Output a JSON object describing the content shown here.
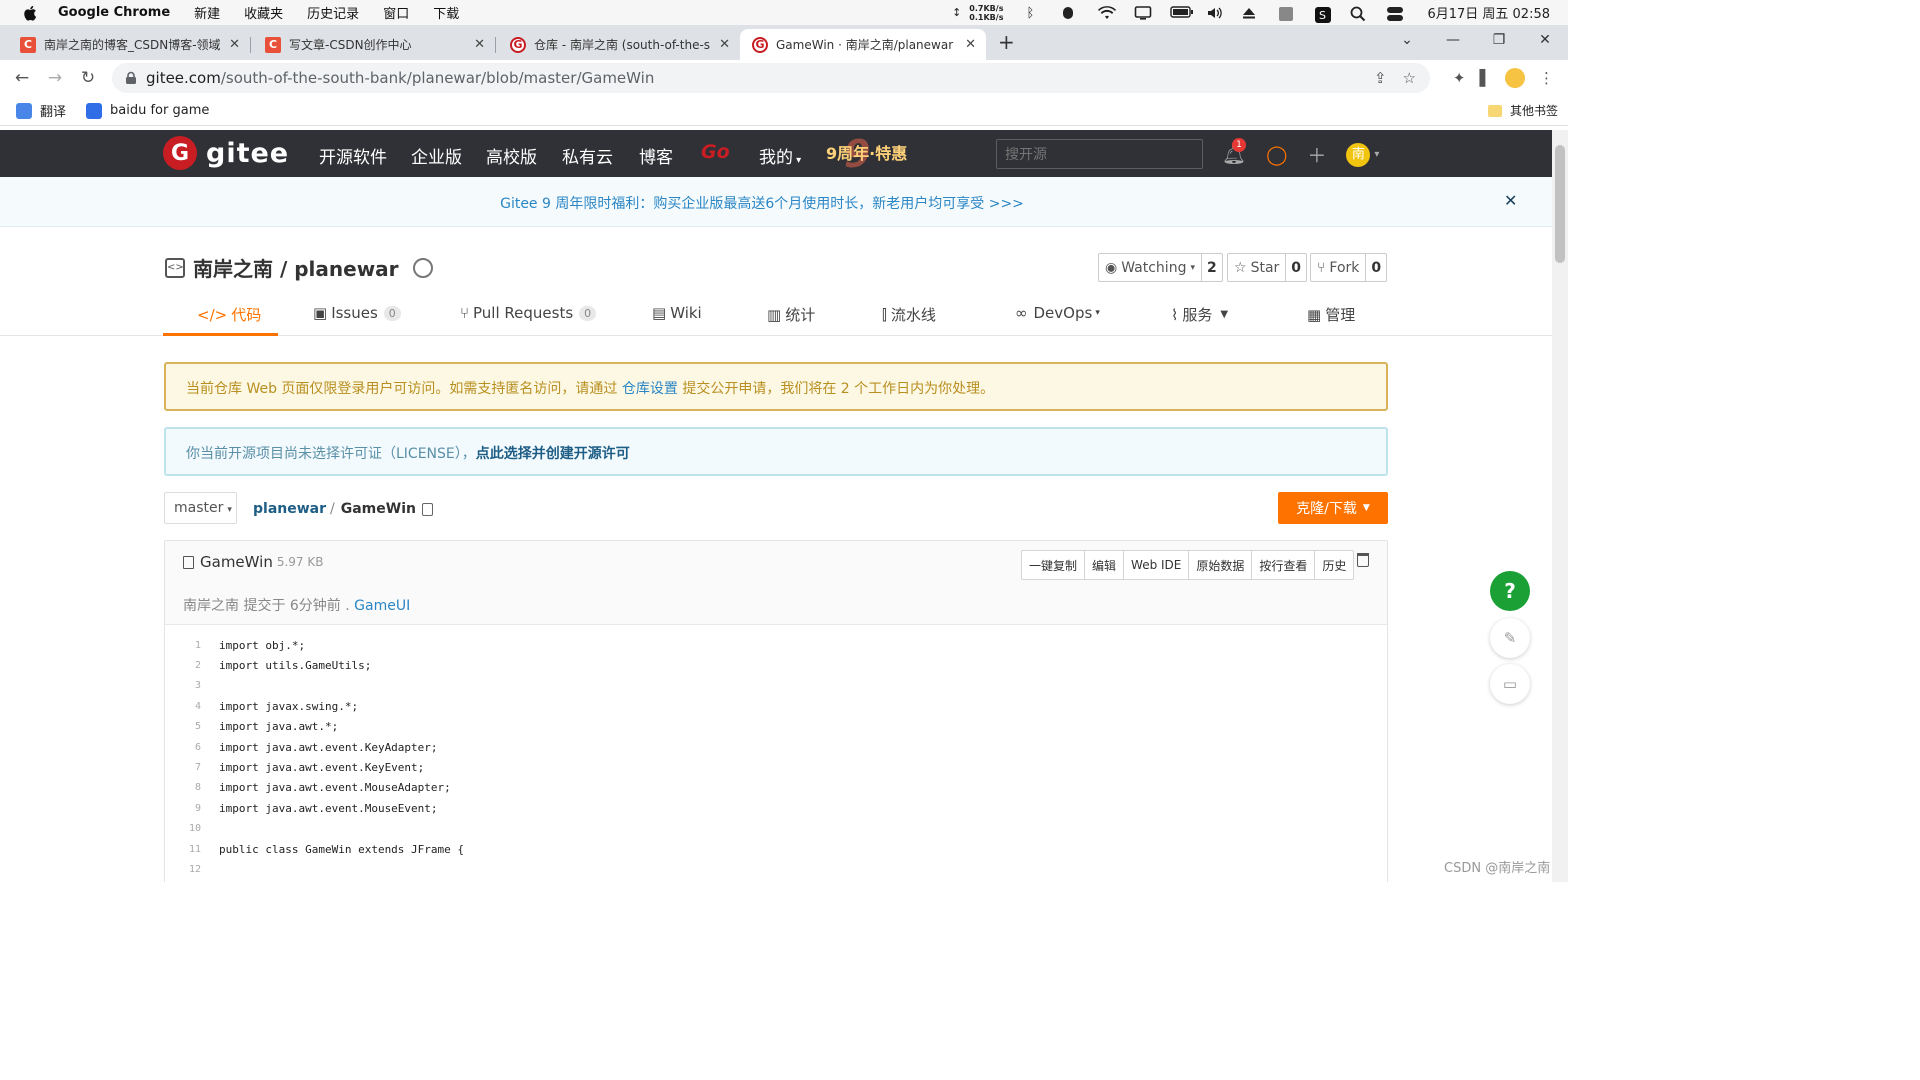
{
  "menubar": {
    "app": "Google Chrome",
    "items": [
      "新建",
      "收藏夹",
      "历史记录",
      "窗口",
      "下载"
    ],
    "speed_up": "0.7KB/s",
    "speed_down": "0.1KB/s",
    "clock": "6月17日 周五 02:58"
  },
  "tabs": [
    {
      "title": "南岸之南的博客_CSDN博客-领域",
      "icon": "csdn-icon"
    },
    {
      "title": "写文章-CSDN创作中心",
      "icon": "csdn-icon"
    },
    {
      "title": "仓库 - 南岸之南 (south-of-the-s",
      "icon": "gitee-icon"
    },
    {
      "title": "GameWin · 南岸之南/planewar",
      "icon": "gitee-icon",
      "active": true
    }
  ],
  "address": {
    "host": "gitee.com",
    "path": "/south-of-the-south-bank/planewar/blob/master/GameWin"
  },
  "bookmarks": {
    "items": [
      {
        "label": "翻译"
      },
      {
        "label": "baidu for game"
      }
    ],
    "other": "其他书签"
  },
  "gitee": {
    "logo": "gitee",
    "nav": [
      "开源软件",
      "企业版",
      "高校版",
      "私有云",
      "博客",
      "Go",
      "我的"
    ],
    "promo": "9周年·特惠",
    "search_placeholder": "搜开源",
    "notification_count": "1",
    "avatar_letter": "南"
  },
  "banner": {
    "text": "Gitee 9 周年限时福利：购买企业版最高送6个月使用时长，新老用户均可享受 >>>"
  },
  "repo": {
    "owner_name": "南岸之南 / planewar",
    "watching_label": "Watching",
    "watching_count": "2",
    "star_label": "Star",
    "star_count": "0",
    "fork_label": "Fork",
    "fork_count": "0"
  },
  "repo_tabs": [
    {
      "label": "代码",
      "icon": "</>",
      "active": true
    },
    {
      "label": "Issues",
      "icon": "▣",
      "count": "0"
    },
    {
      "label": "Pull Requests",
      "icon": "⑂",
      "count": "0"
    },
    {
      "label": "Wiki",
      "icon": "▤"
    },
    {
      "label": "统计",
      "icon": "▥"
    },
    {
      "label": "流水线",
      "icon": "⫿"
    },
    {
      "label": "DevOps",
      "icon": "∞",
      "caret": true
    },
    {
      "label": "服务",
      "icon": "⌇",
      "caret": true
    },
    {
      "label": "管理",
      "icon": "▦"
    }
  ],
  "alerts": {
    "warn_before": "当前仓库 Web 页面仅限登录用户可访问。如需支持匿名访问，请通过 ",
    "warn_link": "仓库设置",
    "warn_after": " 提交公开申请，我们将在 2 个工作日内为你处理。",
    "info_before": "你当前开源项目尚未选择许可证（LICENSE），",
    "info_link": "点此选择并创建开源许可"
  },
  "filenav": {
    "branch": "master",
    "path_root": "planewar",
    "path_file": "GameWin",
    "clone_label": "克隆/下载"
  },
  "file": {
    "name": "GameWin",
    "size": "5.97 KB",
    "commit_author": "南岸之南",
    "commit_text": " 提交于 6分钟前 . ",
    "commit_msg": "GameUI",
    "buttons": [
      "一键复制",
      "编辑",
      "Web IDE",
      "原始数据",
      "按行查看",
      "历史"
    ],
    "lines": [
      "import obj.*;",
      "import utils.GameUtils;",
      "",
      "import javax.swing.*;",
      "import java.awt.*;",
      "import java.awt.event.KeyAdapter;",
      "import java.awt.event.KeyEvent;",
      "import java.awt.event.MouseAdapter;",
      "import java.awt.event.MouseEvent;",
      "",
      "public class GameWin extends JFrame {",
      ""
    ]
  },
  "floating": {
    "help": "?"
  },
  "watermark": "CSDN @南岸之南"
}
